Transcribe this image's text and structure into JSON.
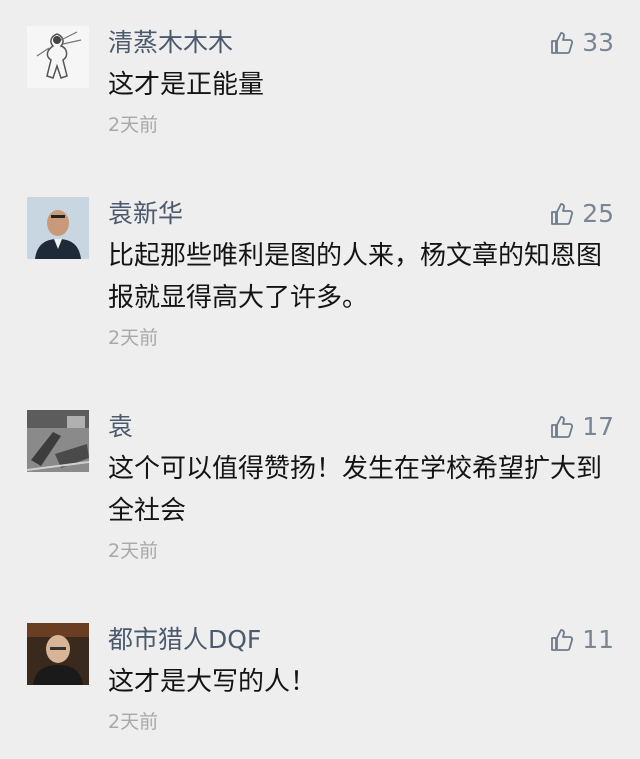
{
  "comments": [
    {
      "name": "清蒸木木木",
      "likes": "33",
      "content": "这才是正能量",
      "time": "2天前",
      "avatar": "sketch-figure-avatar"
    },
    {
      "name": "袁新华",
      "likes": "25",
      "content": "比起那些唯利是图的人来，杨文章的知恩图报就显得高大了许多。",
      "time": "2天前",
      "avatar": "man-portrait-avatar"
    },
    {
      "name": "袁",
      "likes": "17",
      "content": "这个可以值得赞扬！发生在学校希望扩大到全社会",
      "time": "2天前",
      "avatar": "grayscale-scene-avatar"
    },
    {
      "name": "都市猎人DQF",
      "likes": "11",
      "content": "这才是大写的人！",
      "time": "2天前",
      "avatar": "man-dark-portrait-avatar"
    }
  ],
  "colors": {
    "background": "#eeeeee",
    "name": "#4d5a6e",
    "content": "#141414",
    "time": "#a8a8a8",
    "like": "#6f7c8c"
  },
  "icons": {
    "like": "thumb-up-icon"
  }
}
